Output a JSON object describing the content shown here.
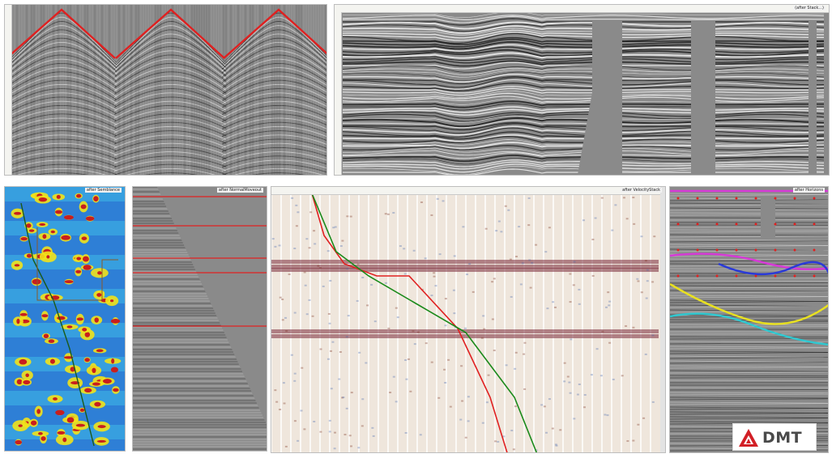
{
  "panels": {
    "shot_gathers": {
      "title": ""
    },
    "stack": {
      "title": "(after Stack...)"
    },
    "semblance": {
      "title": "after Semblance"
    },
    "nmo": {
      "title": "after NormalMoveout"
    },
    "velocity": {
      "title": "after VelocityStack"
    },
    "horizons": {
      "title": "after Horizons"
    }
  },
  "logo": {
    "text": "DMT"
  },
  "colors": {
    "pick_red": "#e02020",
    "velocity_green": "#1a8a1a",
    "horizon_magenta": "#d63ad6",
    "horizon_blue": "#2a3ad8",
    "horizon_yellow": "#e8e020",
    "horizon_cyan": "#30c8d0",
    "logo_red": "#d21f26",
    "logo_gray": "#4a4a4a"
  }
}
